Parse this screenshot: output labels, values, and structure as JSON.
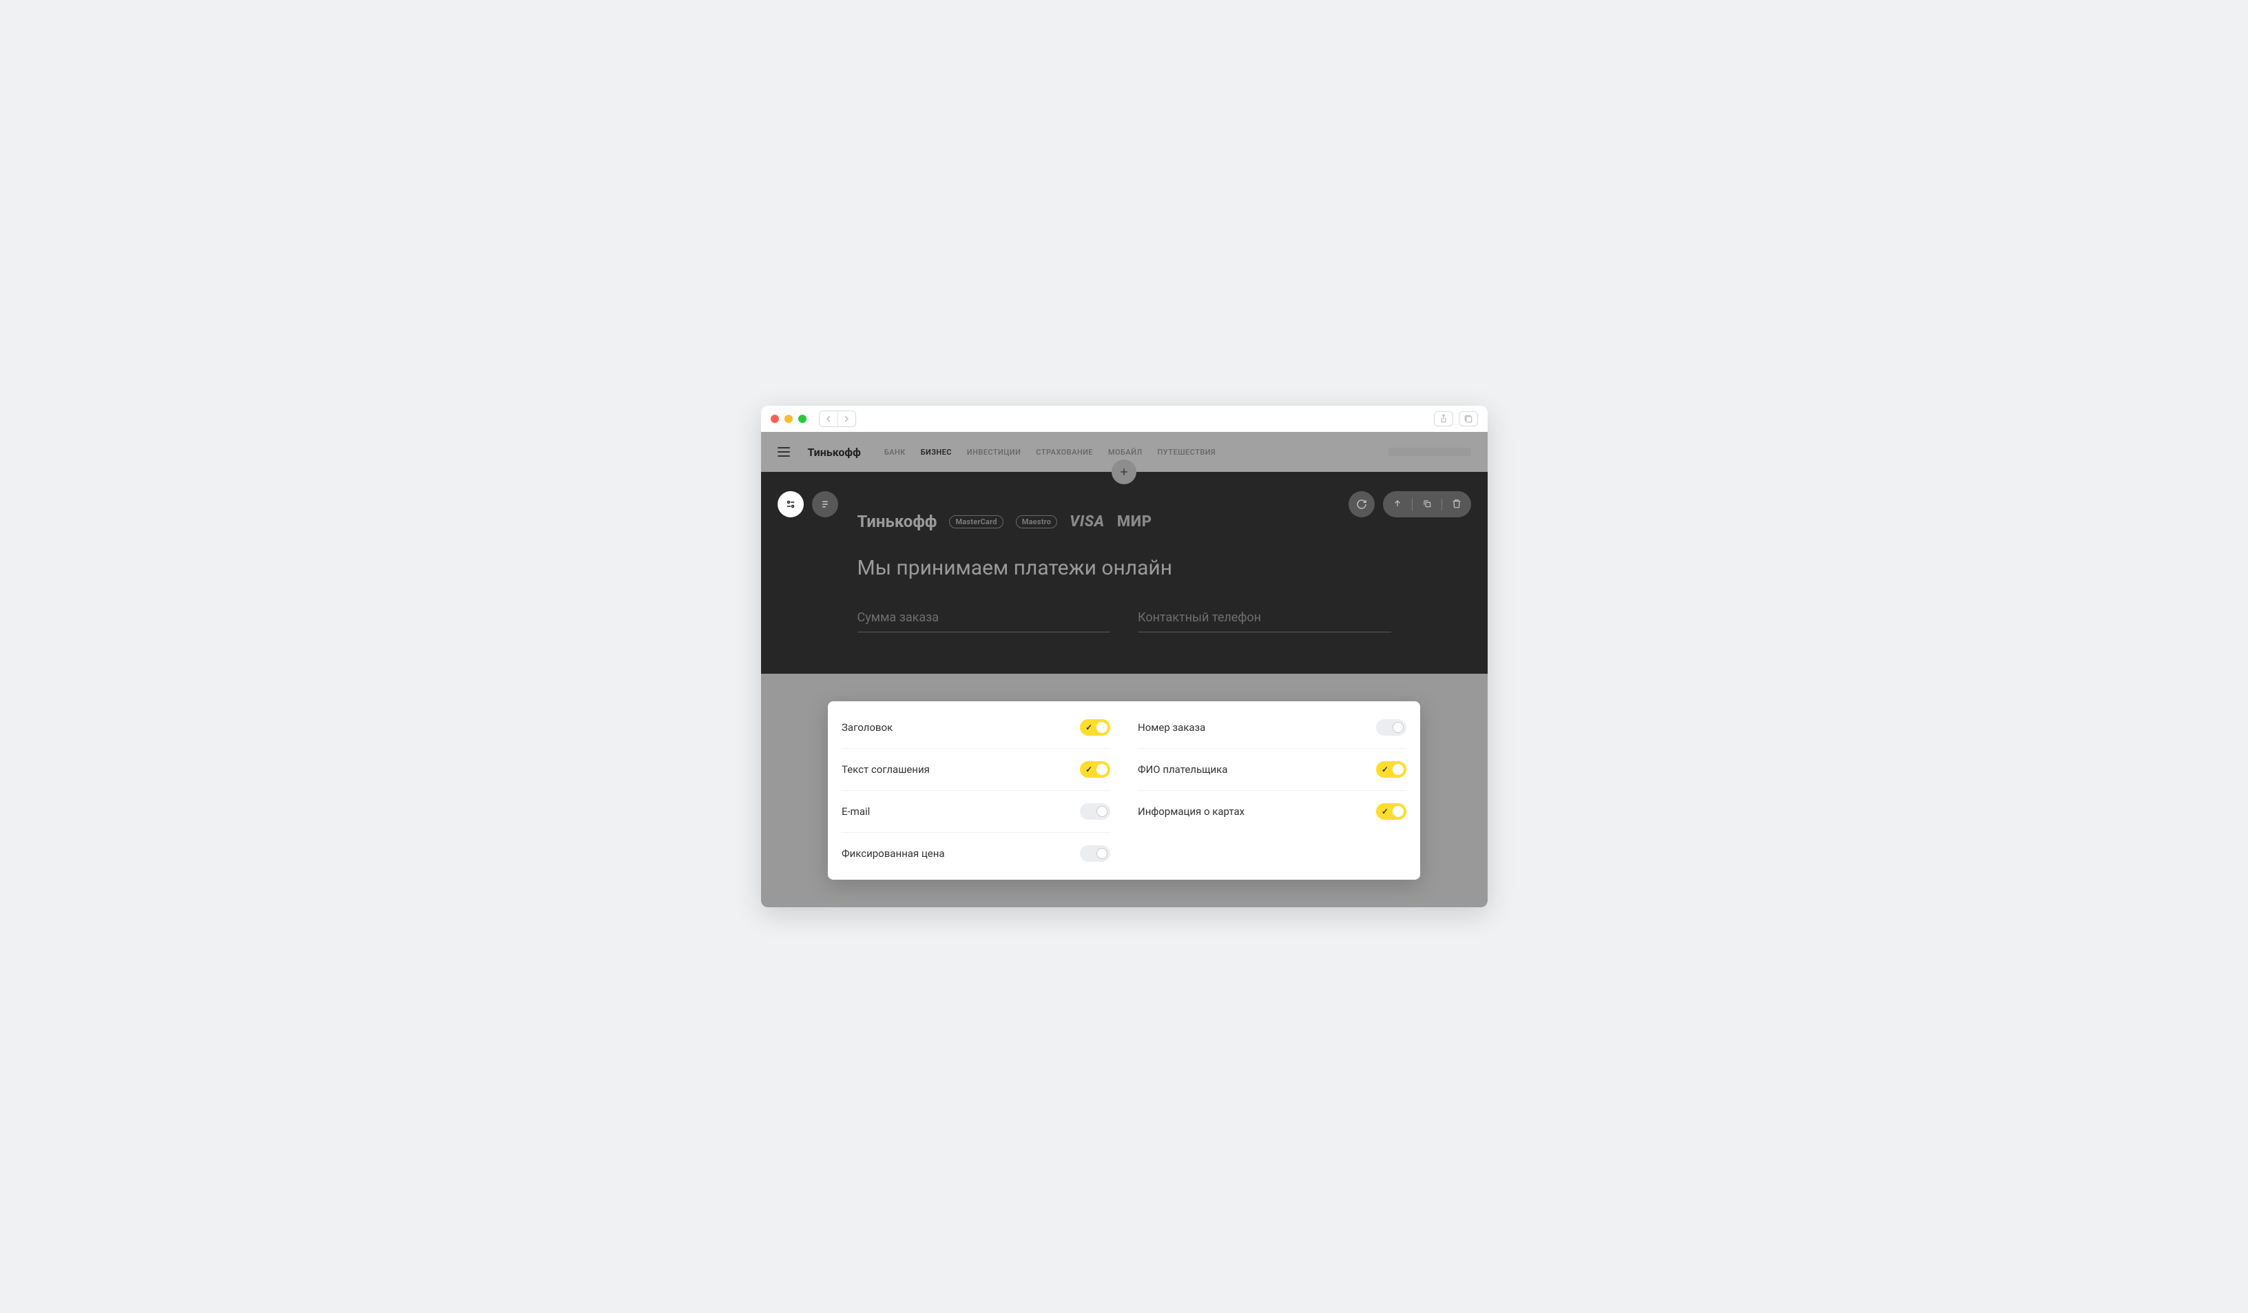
{
  "browser": {
    "traffic": [
      "red",
      "amber",
      "green"
    ]
  },
  "topnav": {
    "brand": "Тинькофф",
    "links": [
      "БАНК",
      "БИЗНЕС",
      "ИНВЕСТИЦИИ",
      "СТРАХОВАНИЕ",
      "МОБАЙЛ",
      "ПУТЕШЕСТВИЯ"
    ],
    "active_index": 1
  },
  "panel": {
    "brand_text": "Тинькофф",
    "title": "Мы принимаем платежи онлайн",
    "field1_placeholder": "Сумма заказа",
    "field2_placeholder": "Контактный телефон"
  },
  "settings": {
    "left": [
      {
        "label": "Заголовок",
        "on": true
      },
      {
        "label": "Текст соглашения",
        "on": true
      },
      {
        "label": "E-mail",
        "on": false
      },
      {
        "label": "Фиксированная цена",
        "on": false
      }
    ],
    "right": [
      {
        "label": "Номер заказа",
        "on": false
      },
      {
        "label": "ФИО плательщика",
        "on": true
      },
      {
        "label": "Информация о картах",
        "on": true
      }
    ]
  },
  "colors": {
    "accent": "#ffdd2d",
    "dark_panel": "#262626",
    "stage_bg": "#999999"
  }
}
